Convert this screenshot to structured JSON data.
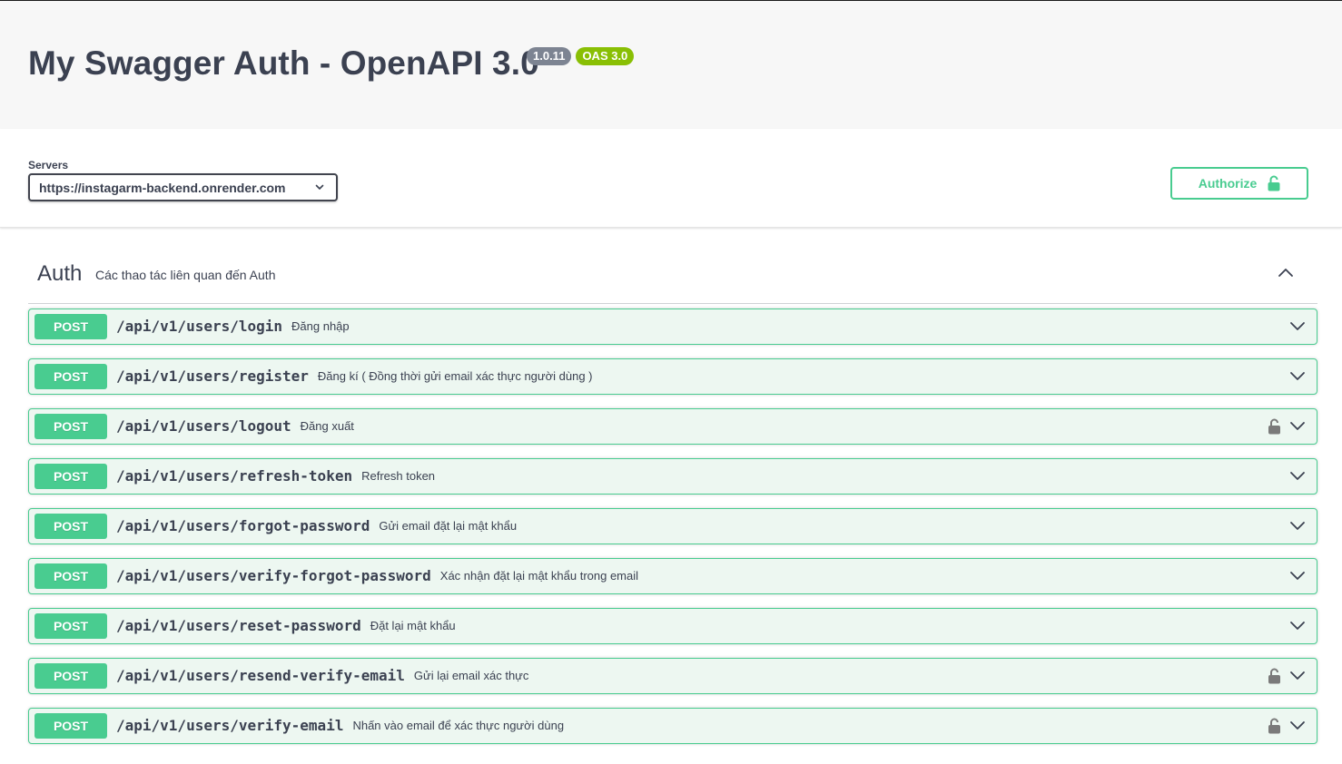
{
  "info": {
    "title": "My Swagger Auth - OpenAPI 3.0",
    "version_badge": "1.0.11",
    "oas_badge": "OAS 3.0"
  },
  "scheme": {
    "servers_label": "Servers",
    "selected_server": "https://instagarm-backend.onrender.com",
    "authorize_label": "Authorize"
  },
  "tag": {
    "name": "Auth",
    "description": "Các thao tác liên quan đến Auth",
    "expanded": true
  },
  "operations": [
    {
      "method": "POST",
      "path": "/api/v1/users/login",
      "summary": "Đăng nhập",
      "locked": false
    },
    {
      "method": "POST",
      "path": "/api/v1/users/register",
      "summary": "Đăng kí ( Đồng thời gửi email xác thực người dùng )",
      "locked": false
    },
    {
      "method": "POST",
      "path": "/api/v1/users/logout",
      "summary": "Đăng xuất",
      "locked": true
    },
    {
      "method": "POST",
      "path": "/api/v1/users/refresh-token",
      "summary": "Refresh token",
      "locked": false
    },
    {
      "method": "POST",
      "path": "/api/v1/users/forgot-password",
      "summary": "Gửi email đặt lại mật khẩu",
      "locked": false
    },
    {
      "method": "POST",
      "path": "/api/v1/users/verify-forgot-password",
      "summary": "Xác nhận đặt lại mật khẩu trong email",
      "locked": false
    },
    {
      "method": "POST",
      "path": "/api/v1/users/reset-password",
      "summary": "Đặt lại mật khẩu",
      "locked": false
    },
    {
      "method": "POST",
      "path": "/api/v1/users/resend-verify-email",
      "summary": "Gửi lại email xác thực",
      "locked": true
    },
    {
      "method": "POST",
      "path": "/api/v1/users/verify-email",
      "summary": "Nhấn vào email để xác thực người dùng",
      "locked": true
    }
  ],
  "colors": {
    "post": "#49cc90",
    "post_bg": "#edf7f1",
    "version_badge": "#7d8492",
    "oas_badge": "#89bf04",
    "text": "#3b4151"
  }
}
